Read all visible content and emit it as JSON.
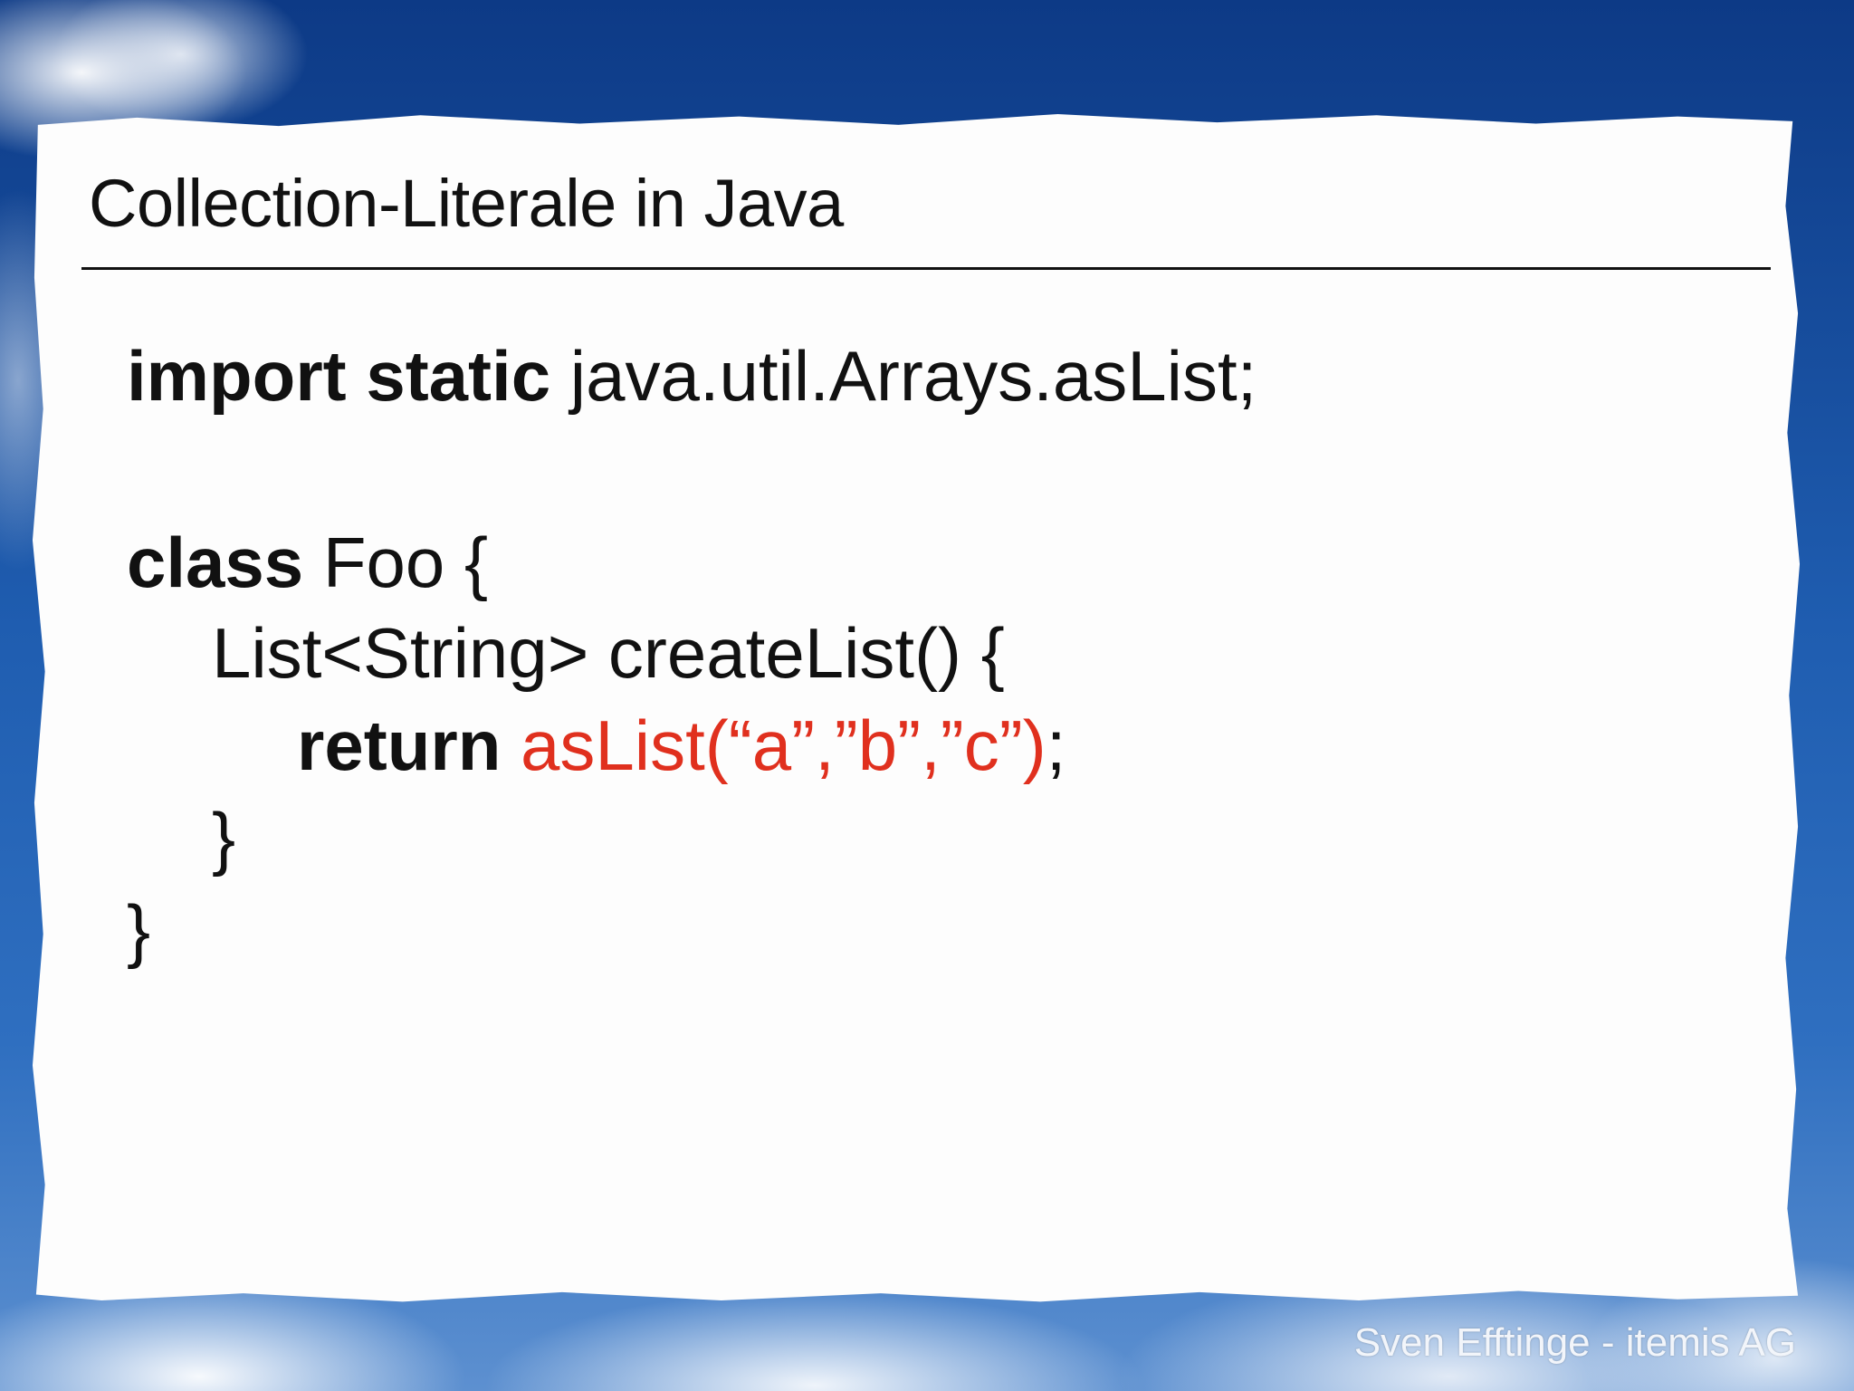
{
  "slide": {
    "title": "Collection-Literale in Java",
    "credit": "Sven Efftinge - itemis AG"
  },
  "code": {
    "line1": {
      "keyword": "import static",
      "rest": " java.util.Arrays.asList;"
    },
    "line2": {
      "keyword": "class",
      "rest": " Foo {"
    },
    "line3": {
      "text": "List<String> createList() {"
    },
    "line4": {
      "keyword": "return",
      "space": " ",
      "highlight": "asList(“a”,”b”,”c”)",
      "rest": ";"
    },
    "line5": {
      "text": "}"
    },
    "line6": {
      "text": "}"
    }
  },
  "colors": {
    "highlight": "#e0301e",
    "paper": "#fdfdfd",
    "sky": "#1f5db0"
  }
}
